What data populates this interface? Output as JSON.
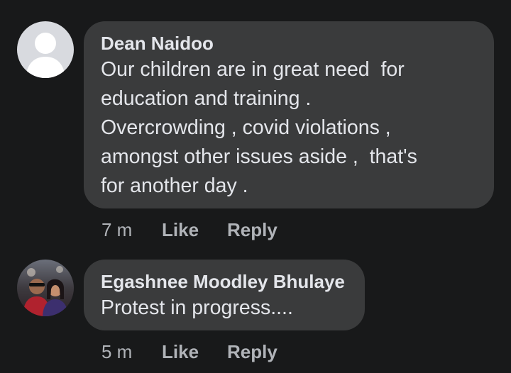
{
  "comments": [
    {
      "author": "Dean Naidoo",
      "text": "Our children are in great need  for\neducation and training .\nOvercrowding , covid violations ,\namongst other issues aside ,  that's\nfor another day .",
      "time": "7 m",
      "like_label": "Like",
      "reply_label": "Reply",
      "avatar_icon": "default-profile-silhouette-icon"
    },
    {
      "author": "Egashnee Moodley Bhulaye",
      "text": "Protest in progress....",
      "time": "5 m",
      "like_label": "Like",
      "reply_label": "Reply",
      "avatar_icon": "profile-photo"
    }
  ],
  "colors": {
    "background": "#18191a",
    "bubble": "#3a3b3c",
    "primary_text": "#e4e6eb",
    "secondary_text": "#b0b3b8"
  }
}
